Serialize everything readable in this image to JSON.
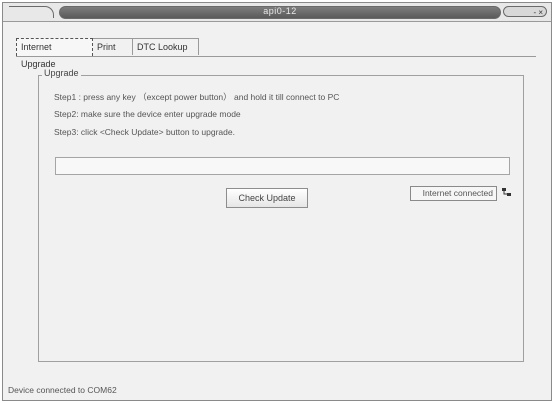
{
  "window": {
    "title": "api0-12"
  },
  "tabs": [
    {
      "label": "Internet Upgrade"
    },
    {
      "label": "Print"
    },
    {
      "label": "DTC Lookup"
    }
  ],
  "upgrade": {
    "group_label": "Upgrade",
    "steps": [
      "Step1 : press any key （except power button） and hold it till connect to PC",
      "Step2: make sure the device enter upgrade mode",
      "Step3: click <Check Update> button to upgrade."
    ],
    "check_update_label": "Check Update",
    "internet_status": "Internet connected",
    "progress": 0
  },
  "statusbar": {
    "text": "Device connected to COM62"
  },
  "window_controls": {
    "label": "- ×"
  }
}
